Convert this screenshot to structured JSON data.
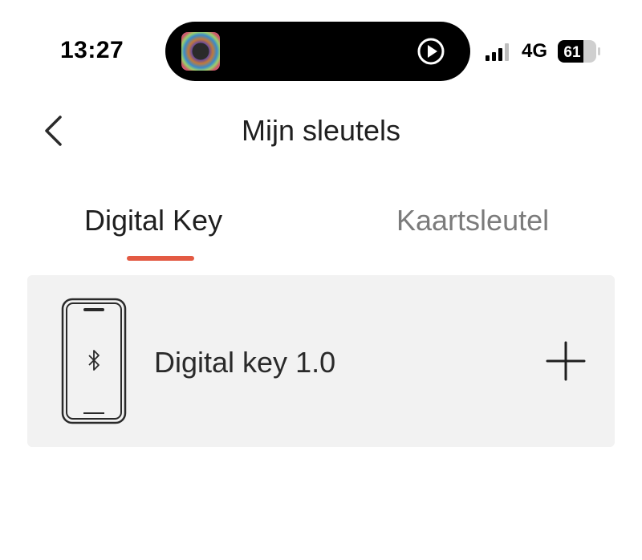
{
  "status_bar": {
    "time": "13:27",
    "network": "4G",
    "battery": "61",
    "icons": [
      "album-art-icon",
      "play-icon",
      "signal-icon",
      "battery-icon"
    ]
  },
  "header": {
    "title": "Mijn sleutels",
    "back_icon": "chevron-left-icon"
  },
  "tabs": [
    {
      "label": "Digital Key",
      "active": true
    },
    {
      "label": "Kaartsleutel",
      "active": false
    }
  ],
  "colors": {
    "accent": "#e35a43",
    "card_bg": "#f2f2f2",
    "inactive_tab": "#7b7b7b"
  },
  "key_card": {
    "label": "Digital key 1.0",
    "icon": "phone-bluetooth-icon",
    "action_icon": "plus-icon"
  }
}
